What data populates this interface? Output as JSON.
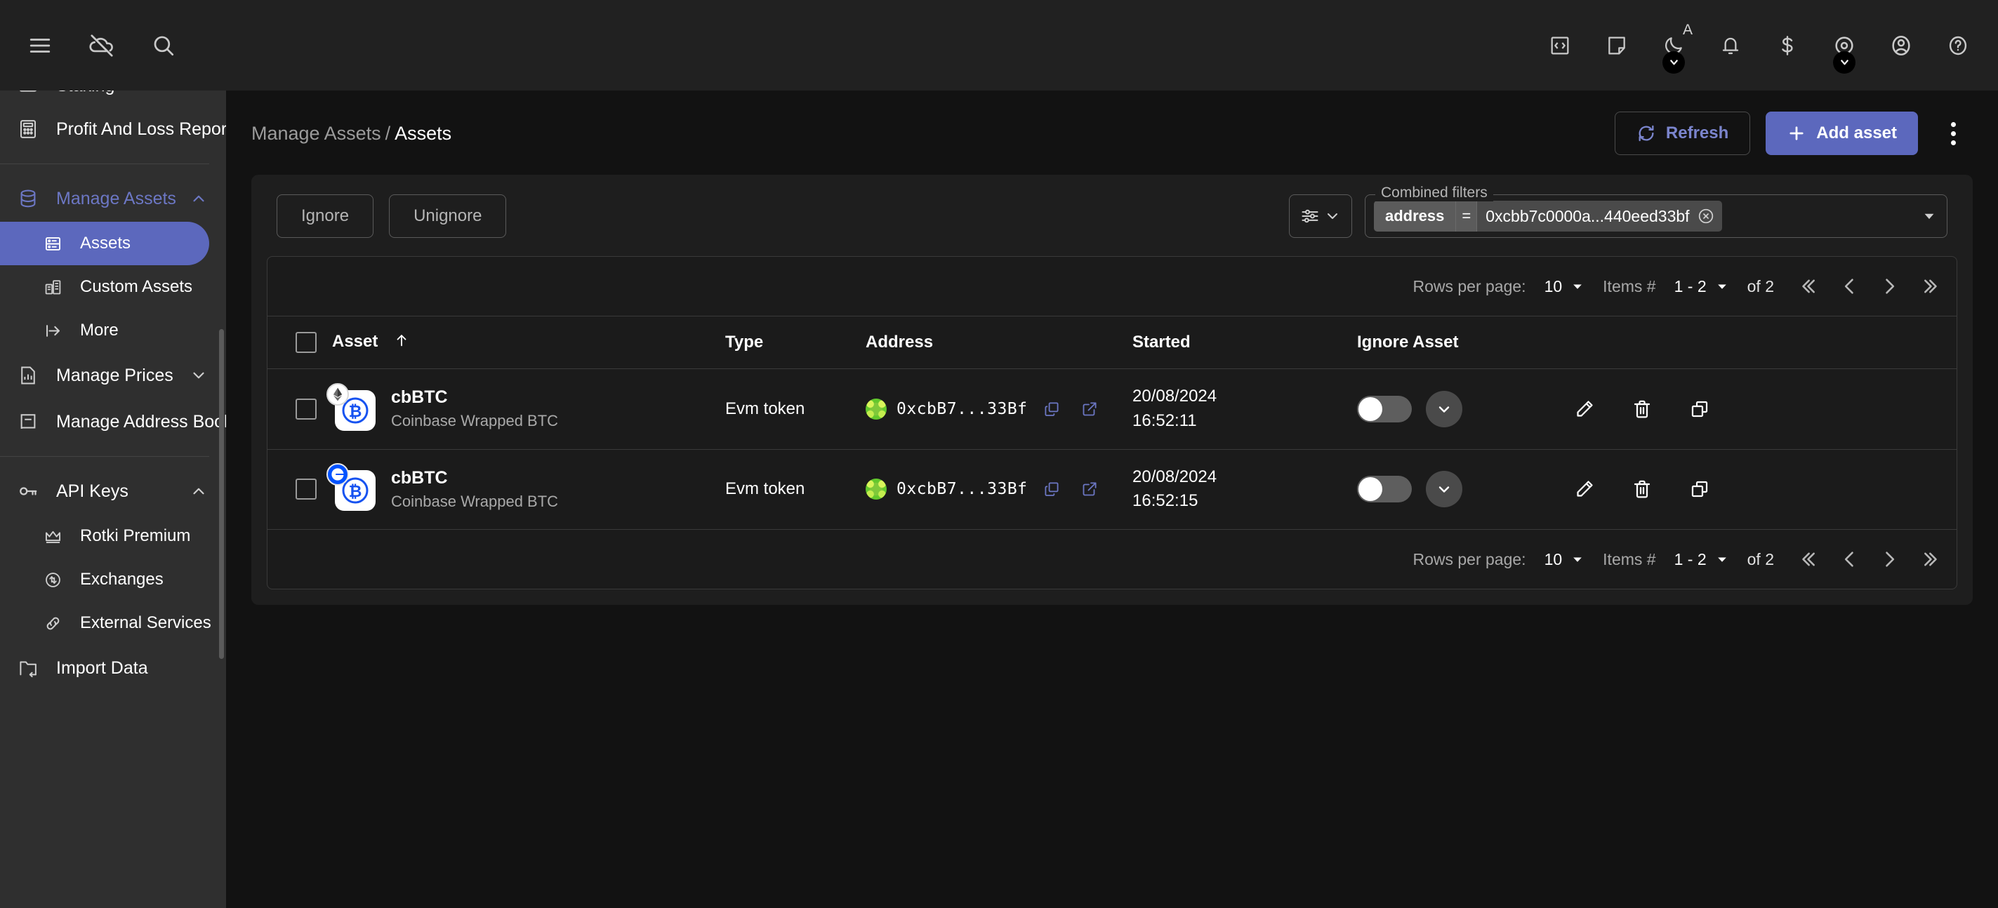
{
  "topbar": {
    "left_icons": [
      {
        "name": "menu-icon",
        "label": "Menu"
      },
      {
        "name": "cloud-off-icon",
        "label": "Cloud sync off"
      },
      {
        "name": "search-icon",
        "label": "Search"
      }
    ],
    "right_icons": [
      {
        "name": "code-icon",
        "label": "Developer"
      },
      {
        "name": "note-icon",
        "label": "Notes"
      },
      {
        "name": "theme-moon-icon",
        "label": "Theme",
        "badge_letter": "A",
        "has_chevron": true
      },
      {
        "name": "notifications-bell-icon",
        "label": "Notifications"
      },
      {
        "name": "currency-dollar-icon",
        "label": "Currency"
      },
      {
        "name": "privacy-eye-icon",
        "label": "Privacy mode",
        "has_chevron": true
      },
      {
        "name": "account-icon",
        "label": "Account"
      },
      {
        "name": "help-icon",
        "label": "Help"
      }
    ]
  },
  "sidebar": {
    "cut_item": {
      "label": "Staking",
      "icon": "staking-icon"
    },
    "items": [
      {
        "label": "Profit And Loss Report",
        "icon": "calculator-icon",
        "type": "item"
      },
      {
        "label": "Manage Assets",
        "icon": "database-icon",
        "type": "group",
        "expanded": true,
        "active_group": true
      },
      {
        "label": "Assets",
        "icon": "assets-icon",
        "type": "sub",
        "active": true
      },
      {
        "label": "Custom Assets",
        "icon": "custom-assets-icon",
        "type": "sub",
        "active": false
      },
      {
        "label": "More",
        "icon": "arrow-right-icon",
        "type": "sub",
        "active": false
      },
      {
        "label": "Manage Prices",
        "icon": "prices-chart-icon",
        "type": "group",
        "expanded": false
      },
      {
        "label": "Manage Address Book",
        "icon": "address-book-icon",
        "type": "item"
      },
      {
        "label": "API Keys",
        "icon": "key-icon",
        "type": "group",
        "expanded": true
      },
      {
        "label": "Rotki Premium",
        "icon": "crown-icon",
        "type": "sub",
        "active": false
      },
      {
        "label": "Exchanges",
        "icon": "exchange-icon",
        "type": "sub",
        "active": false
      },
      {
        "label": "External Services",
        "icon": "link-icon",
        "type": "sub",
        "active": false
      },
      {
        "label": "Import Data",
        "icon": "import-folder-icon",
        "type": "item"
      }
    ]
  },
  "header": {
    "breadcrumb_parent": "Manage Assets",
    "breadcrumb_separator": "/",
    "breadcrumb_current": "Assets",
    "refresh_label": "Refresh",
    "add_asset_label": "Add asset"
  },
  "filters": {
    "ignore_label": "Ignore",
    "unignore_label": "Unignore",
    "combined_filters_legend": "Combined filters",
    "chip": {
      "key": "address",
      "operator": "=",
      "value": "0xcbb7c0000a...440eed33bf"
    }
  },
  "pagination": {
    "rows_per_page_label": "Rows per page:",
    "rows_per_page_value": "10",
    "items_label": "Items #",
    "items_range": "1 - 2",
    "total_label": "of 2"
  },
  "table": {
    "columns": [
      {
        "key": "checkbox",
        "label": ""
      },
      {
        "key": "asset",
        "label": "Asset",
        "sorted": "asc"
      },
      {
        "key": "type",
        "label": "Type"
      },
      {
        "key": "address",
        "label": "Address"
      },
      {
        "key": "started",
        "label": "Started"
      },
      {
        "key": "ignore",
        "label": "Ignore Asset"
      },
      {
        "key": "actions",
        "label": ""
      }
    ],
    "rows": [
      {
        "symbol": "cbBTC",
        "name": "Coinbase Wrapped BTC",
        "chain_badge": "ethereum",
        "type": "Evm token",
        "address": "0xcbB7...33Bf",
        "started_date": "20/08/2024",
        "started_time": "16:52:11",
        "ignored": false
      },
      {
        "symbol": "cbBTC",
        "name": "Coinbase Wrapped BTC",
        "chain_badge": "base",
        "type": "Evm token",
        "address": "0xcbB7...33Bf",
        "started_date": "20/08/2024",
        "started_time": "16:52:15",
        "ignored": false
      }
    ]
  },
  "colors": {
    "accent": "#5c68bd",
    "accent_text": "#7b85cd",
    "sidebar_bg": "#2f2f2f",
    "topbar_bg": "#212121",
    "page_bg": "#121212",
    "card_bg": "#1e1e1e",
    "bitcoin_blue": "#0052ff"
  }
}
